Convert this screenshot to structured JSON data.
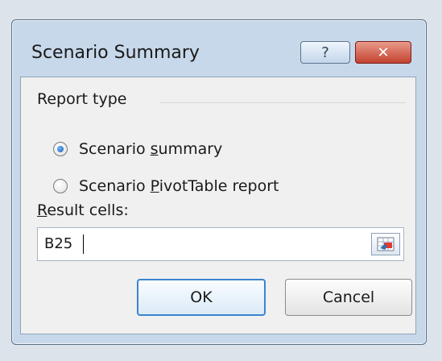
{
  "dialog": {
    "title": "Scenario Summary",
    "help_label": "?",
    "close_label": "✕"
  },
  "report_type": {
    "label": "Report type",
    "options": [
      {
        "prefix": "Scenario ",
        "accel": "s",
        "suffix": "ummary",
        "selected": true
      },
      {
        "prefix": "Scenario ",
        "accel": "P",
        "suffix": "ivotTable report",
        "selected": false
      }
    ]
  },
  "result_cells": {
    "label_accel": "R",
    "label_rest": "esult cells:",
    "value": "B25"
  },
  "buttons": {
    "ok": "OK",
    "cancel": "Cancel"
  },
  "icons": {
    "help": "question-mark-icon",
    "close": "close-icon",
    "collapse": "range-selector-icon"
  }
}
